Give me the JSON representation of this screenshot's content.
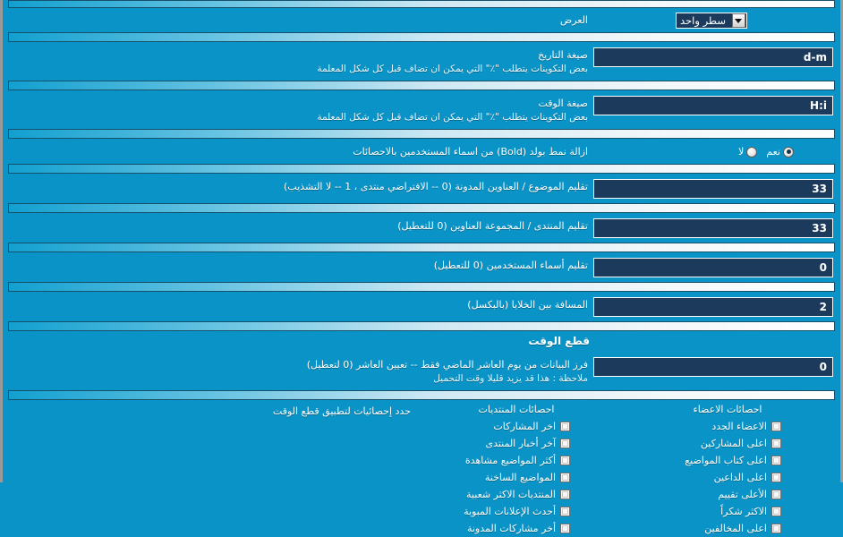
{
  "theme": {
    "background": "#0a93c6",
    "input_bg": "#1b3a5c",
    "input_border": "#ffffff",
    "text": "#ffffff",
    "frame_border": "#9a9a9a"
  },
  "rows": {
    "display": {
      "label": "العرض",
      "select_value": "سطر واحد",
      "arrow_icon": "chevron-down-icon"
    },
    "date_format": {
      "label": "صيغة التاريخ",
      "sub": "بعض التكوينات يتطلب \"٪\" التي يمكن ان تضاف قبل كل شكل المعلمة",
      "value": "d-m"
    },
    "time_format": {
      "label": "صيغة الوقت",
      "sub": "بعض التكوينات يتطلب \"٪\" التي يمكن ان تضاف قبل كل شكل المعلمة",
      "value": "H:i"
    },
    "remove_bold": {
      "label": "ازالة نمط بولد (Bold) من اسماء المستخدمين بالاحصائات",
      "options": [
        {
          "label": "نعم",
          "selected": true
        },
        {
          "label": "لا",
          "selected": false
        }
      ]
    },
    "trim_topic": {
      "label": "تقليم الموضوع / العناوين المدونة (0 -- الافتراضي منتدى ، 1 -- لا التشذيب)",
      "value": "33"
    },
    "trim_forum": {
      "label": "تقليم المنتدى / المجموعة العناوين (0 للتعطيل)",
      "value": "33"
    },
    "trim_usernames": {
      "label": "تقليم أسماء المستخدمين (0 للتعطيل)",
      "value": "0"
    },
    "cell_spacing": {
      "label": "المسافة بين الخلايا (بالبكسل)",
      "value": "2"
    },
    "time_cut_section": {
      "label": "قطع الوقت"
    },
    "time_cut": {
      "label": "فرز البيانات من يوم العاشر الماضي فقط -- تعيين العاشر (0 لتعطيل)",
      "sub": "ملاحظة : هذا قد يزيد قليلا وقت التحميل",
      "value": "0"
    },
    "apply_stats": {
      "label": "حدد إحصائيات لتطبيق قطع الوقت"
    }
  },
  "checkbox_columns": [
    {
      "id": "members",
      "heading": "احصائات الاعضاء",
      "items": [
        {
          "label": "الاعضاء الجدد",
          "checked": false
        },
        {
          "label": "اعلى المشاركين",
          "checked": false
        },
        {
          "label": "اعلى كتاب المواضيع",
          "checked": false
        },
        {
          "label": "اعلى الداعين",
          "checked": false
        },
        {
          "label": "الأعلى تقييم",
          "checked": false
        },
        {
          "label": "الاكثر شكراً",
          "checked": false
        },
        {
          "label": "اعلى المخالفين",
          "checked": false
        }
      ]
    },
    {
      "id": "forums",
      "heading": "احصائات المنتديات",
      "items": [
        {
          "label": "اخر المشاركات",
          "checked": false
        },
        {
          "label": "آخر أخبار المنتدى",
          "checked": false
        },
        {
          "label": "أكثر المواضيع مشاهدة",
          "checked": false
        },
        {
          "label": "المواضيع الساخنة",
          "checked": false
        },
        {
          "label": "المنتديات الاكثر شعبية",
          "checked": false
        },
        {
          "label": "أحدث الإعلانات المبوبة",
          "checked": false
        },
        {
          "label": "أخر مشاركات المدونة",
          "checked": false
        }
      ]
    }
  ]
}
